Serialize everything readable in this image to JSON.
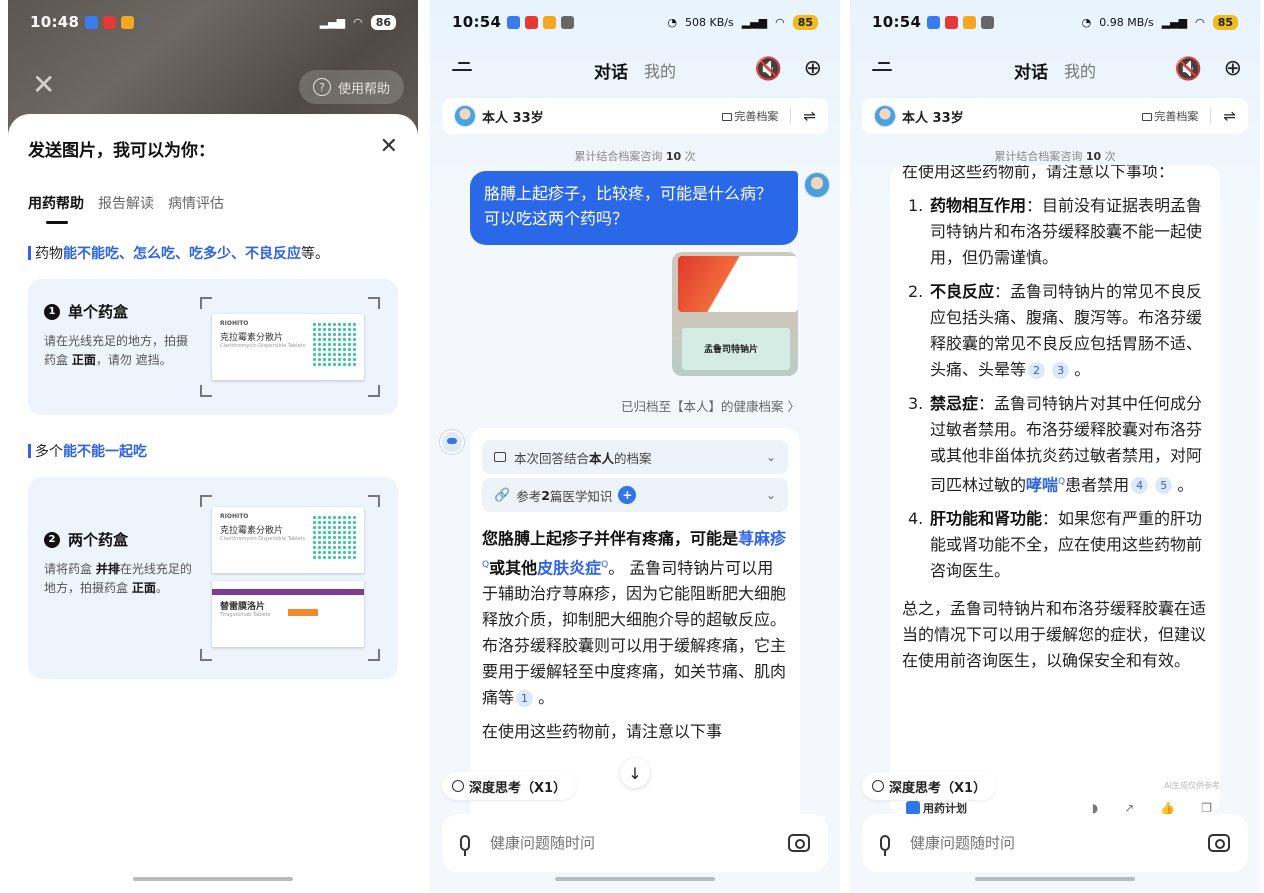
{
  "panel1": {
    "status": {
      "time": "10:48",
      "battery": "86"
    },
    "help_button": "使用帮助",
    "title": "发送图片，我可以为你：",
    "tabs": [
      "用药帮助",
      "报告解读",
      "病情评估"
    ],
    "section1": {
      "prefix": "药物",
      "highlight": "能不能吃、怎么吃、吃多少、不良反应",
      "suffix": "等。"
    },
    "card1": {
      "num": "1",
      "title": "单个药盒",
      "desc_a": "请在光线充足的地方，拍摄药盒 ",
      "desc_b": "正面",
      "desc_c": "，请勿 遮挡。",
      "box": {
        "brand": "RIOHITO",
        "name": "克拉霉素分散片",
        "sub": "Clarithromycin Dispersible Tablets"
      }
    },
    "section2": {
      "prefix": "多个",
      "highlight": "能不能一起吃"
    },
    "card2": {
      "num": "2",
      "title": "两个药盒",
      "desc_a": "请将药盒 ",
      "desc_b": "并排",
      "desc_c": "在光线充足的地方，拍摄药盒 ",
      "desc_d": "正面",
      "desc_e": "。",
      "box1": {
        "brand": "RIOHITO",
        "name": "克拉霉素分散片",
        "sub": "Clarithromycin Dispersible Tablets"
      },
      "box2": {
        "name": "替雷膜洛片",
        "sub": "Tiragolumab Tablets"
      }
    }
  },
  "panel2": {
    "status": {
      "time": "10:54",
      "speed": "508 KB/s",
      "battery": "85"
    },
    "nav": {
      "active": "对话",
      "other": "我的"
    },
    "profile": {
      "name": "本人 33岁",
      "archive_label": "完善档案"
    },
    "consult": {
      "prefix": "累计结合档案咨询 ",
      "count": "10",
      "suffix": " 次"
    },
    "user_message": "胳膊上起疹子，比较疼，可能是什么病？可以吃这两个药吗？",
    "photo_label": "孟鲁司特钠片",
    "archived": "已归档至【本人】的健康档案 〉",
    "chip1": {
      "a": "本次回答结合 ",
      "b": "本人",
      "c": " 的档案"
    },
    "chip2": {
      "a": "参考 ",
      "b": "2",
      "c": " 篇医学知识"
    },
    "answer": {
      "bold_a": "您胳膊上起疹子并伴有疼痛，可能是",
      "term1": "荨麻疹",
      "bold_b": "或其他",
      "term2": "皮肤炎症",
      "rest": "。 孟鲁司特钠片可以用于辅助治疗荨麻疹，因为它能阻断肥大细胞释放介质，抑制肥大细胞介导的超敏反应。布洛芬缓释胶囊则可以用于缓解疼痛，它主要用于缓解轻至中度疼痛，如关节痛、肌肉痛等",
      "ref": "1",
      "end": "。",
      "p2": "在使用这些药物前，请注意以下事"
    },
    "deep_think": "深度思考（X1）",
    "input_placeholder": "健康问题随时问"
  },
  "panel3": {
    "status": {
      "time": "10:54",
      "speed": "0.98 MB/s",
      "battery": "85"
    },
    "nav": {
      "active": "对话",
      "other": "我的"
    },
    "profile": {
      "name": "本人 33岁",
      "archive_label": "完善档案"
    },
    "consult": {
      "prefix": "累计结合档案咨询 ",
      "count": "10",
      "suffix": " 次"
    },
    "intro": "在使用这些药物前，请注意以下事项：",
    "items": [
      {
        "n": "1.",
        "title": "药物相互作用",
        "text": "：目前没有证据表明孟鲁司特钠片和布洛芬缓释胶囊不能一起使用，但仍需谨慎。"
      },
      {
        "n": "2.",
        "title": "不良反应",
        "text": "：孟鲁司特钠片的常见不良反应包括头痛、腹痛、腹泻等。布洛芬缓释胶囊的常见不良反应包括胃肠不适、头痛、头晕等",
        "refs": [
          "2",
          "3"
        ]
      },
      {
        "n": "3.",
        "title": "禁忌症",
        "text": "：孟鲁司特钠片对其中任何成分过敏者禁用。布洛芬缓释胶囊对布洛芬或其他非甾体抗炎药过敏者禁用，对阿司匹林过敏的",
        "term": "哮喘",
        "text2": "患者禁用",
        "refs": [
          "4",
          "5"
        ]
      },
      {
        "n": "4.",
        "title": "肝功能和肾功能",
        "text": "：如果您有严重的肝功能或肾功能不全，应在使用这些药物前咨询医生。"
      }
    ],
    "conclusion": "总之，孟鲁司特钠片和布洛芬缓释胶囊在适当的情况下可以用于缓解您的症状，但建议在使用前咨询医生，以确保安全和有效。",
    "watermark": "AI生成仅供参考",
    "deep_think": "深度思考（X1）",
    "plan_label": "用药计划",
    "input_placeholder": "健康问题随时问"
  }
}
